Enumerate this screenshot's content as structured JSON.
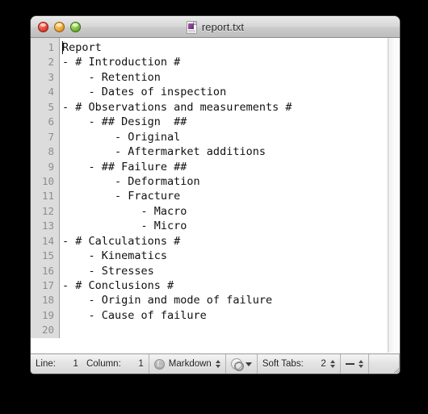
{
  "window": {
    "title": "report.txt",
    "doc_icon": "text-document-icon",
    "controls": {
      "close": "close-button",
      "minimize": "minimize-button",
      "zoom": "zoom-button"
    }
  },
  "editor": {
    "caret": {
      "line": 1,
      "column": 1
    },
    "line_numbers": [
      "1",
      "2",
      "3",
      "4",
      "5",
      "6",
      "7",
      "8",
      "9",
      "10",
      "11",
      "12",
      "13",
      "14",
      "15",
      "16",
      "17",
      "18",
      "19",
      "20"
    ],
    "lines": [
      "Report",
      "- # Introduction #",
      "    - Retention",
      "    - Dates of inspection",
      "- # Observations and measurements #",
      "    - ## Design  ##",
      "        - Original",
      "        - Aftermarket additions",
      "    - ## Failure ##",
      "        - Deformation",
      "        - Fracture",
      "            - Macro",
      "            - Micro",
      "- # Calculations #",
      "    - Kinematics",
      "    - Stresses",
      "- # Conclusions #",
      "    - Origin and mode of failure",
      "    - Cause of failure",
      ""
    ]
  },
  "statusbar": {
    "line_label": "Line:",
    "line_value": "1",
    "column_label": "Column:",
    "column_value": "1",
    "syntax_badge": "L",
    "syntax_mode": "Markdown",
    "gear_icon": "gear-icon",
    "soft_tabs_label": "Soft Tabs:",
    "soft_tabs_value": "2",
    "line_endings_value": "—"
  },
  "colors": {
    "desktop_background": "#000000",
    "titlebar_top": "#e8e8e8",
    "titlebar_bottom": "#bdbdbd",
    "editor_background": "#ffffff",
    "gutter_background": "#dcdcdc",
    "gutter_text": "#8d8d8d",
    "code_text": "#111111",
    "statusbar_background": "#e3e3e3",
    "traffic_red": "#e8493b",
    "traffic_yellow": "#f0a93a",
    "traffic_green": "#7dc040"
  }
}
